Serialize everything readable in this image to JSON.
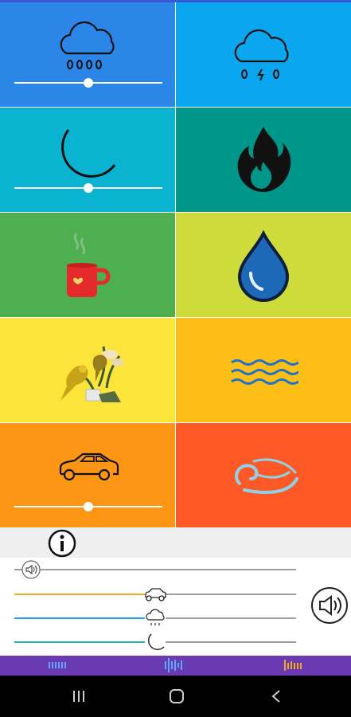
{
  "colors": {
    "tiles": [
      "#2b86e8",
      "#0aa6ef",
      "#0ab4d1",
      "#00968a",
      "#4fae4f",
      "#cddc3b",
      "#fde43a",
      "#fdbf16",
      "#fd9614",
      "#fd5825"
    ],
    "mixer_car": "#f5a623",
    "mixer_rain": "#2b9ee5",
    "mixer_moon": "#2bb3b3",
    "bottomnav": "#6a3ab3",
    "system_nav": "#000000"
  },
  "tiles": [
    {
      "name": "rain",
      "icon": "rain-cloud-icon",
      "slider_level": 0.5
    },
    {
      "name": "thunderstorm",
      "icon": "storm-cloud-icon"
    },
    {
      "name": "night",
      "icon": "crescent-moon-icon",
      "slider_level": 0.5
    },
    {
      "name": "fire",
      "icon": "flame-icon"
    },
    {
      "name": "coffee",
      "icon": "coffee-cup-icon"
    },
    {
      "name": "water-drop",
      "icon": "water-drop-icon"
    },
    {
      "name": "birds",
      "icon": "birds-icon"
    },
    {
      "name": "waves",
      "icon": "waves-icon"
    },
    {
      "name": "car",
      "icon": "car-icon",
      "slider_level": 0.5
    },
    {
      "name": "wind",
      "icon": "wind-icon"
    }
  ],
  "info": {
    "icon": "info-icon"
  },
  "mixer": {
    "master_level": 0.06,
    "car_level": 0.5,
    "rain_level": 0.5,
    "moon_level": 0.5,
    "master_volume_icon": "speaker-icon"
  },
  "bottom_nav": [
    "sounds-tab",
    "mixer-tab",
    "timer-tab"
  ],
  "system_nav": [
    "recent-apps-icon",
    "home-icon",
    "back-icon"
  ]
}
